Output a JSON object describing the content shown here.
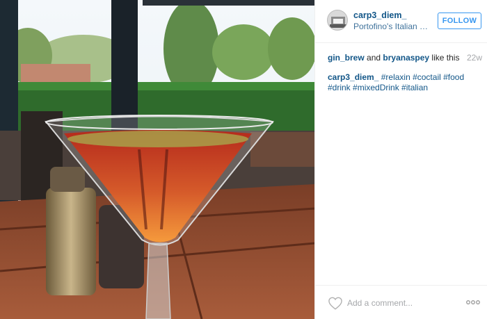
{
  "post": {
    "photo": {
      "subject": "cocktail-in-martini-glass"
    }
  },
  "header": {
    "username": "carp3_diem_",
    "location": "Portofino's Italian R...",
    "follow_label": "FOLLOW"
  },
  "likes": {
    "liker_1": "gin_brew",
    "connector": " and ",
    "liker_2": "bryanaspey",
    "suffix": " like this",
    "time": "22w"
  },
  "caption": {
    "author": "carp3_diem_",
    "text": " #relaxin #coctail #food #drink #mixedDrink #italian"
  },
  "footer": {
    "comment_placeholder": "Add a comment...",
    "like_icon": "heart-outline-icon",
    "more_icon": "ellipsis-icon"
  },
  "colors": {
    "link": "#125688",
    "location": "#3f729b",
    "accent": "#3897f0",
    "muted": "#a5a7aa"
  }
}
